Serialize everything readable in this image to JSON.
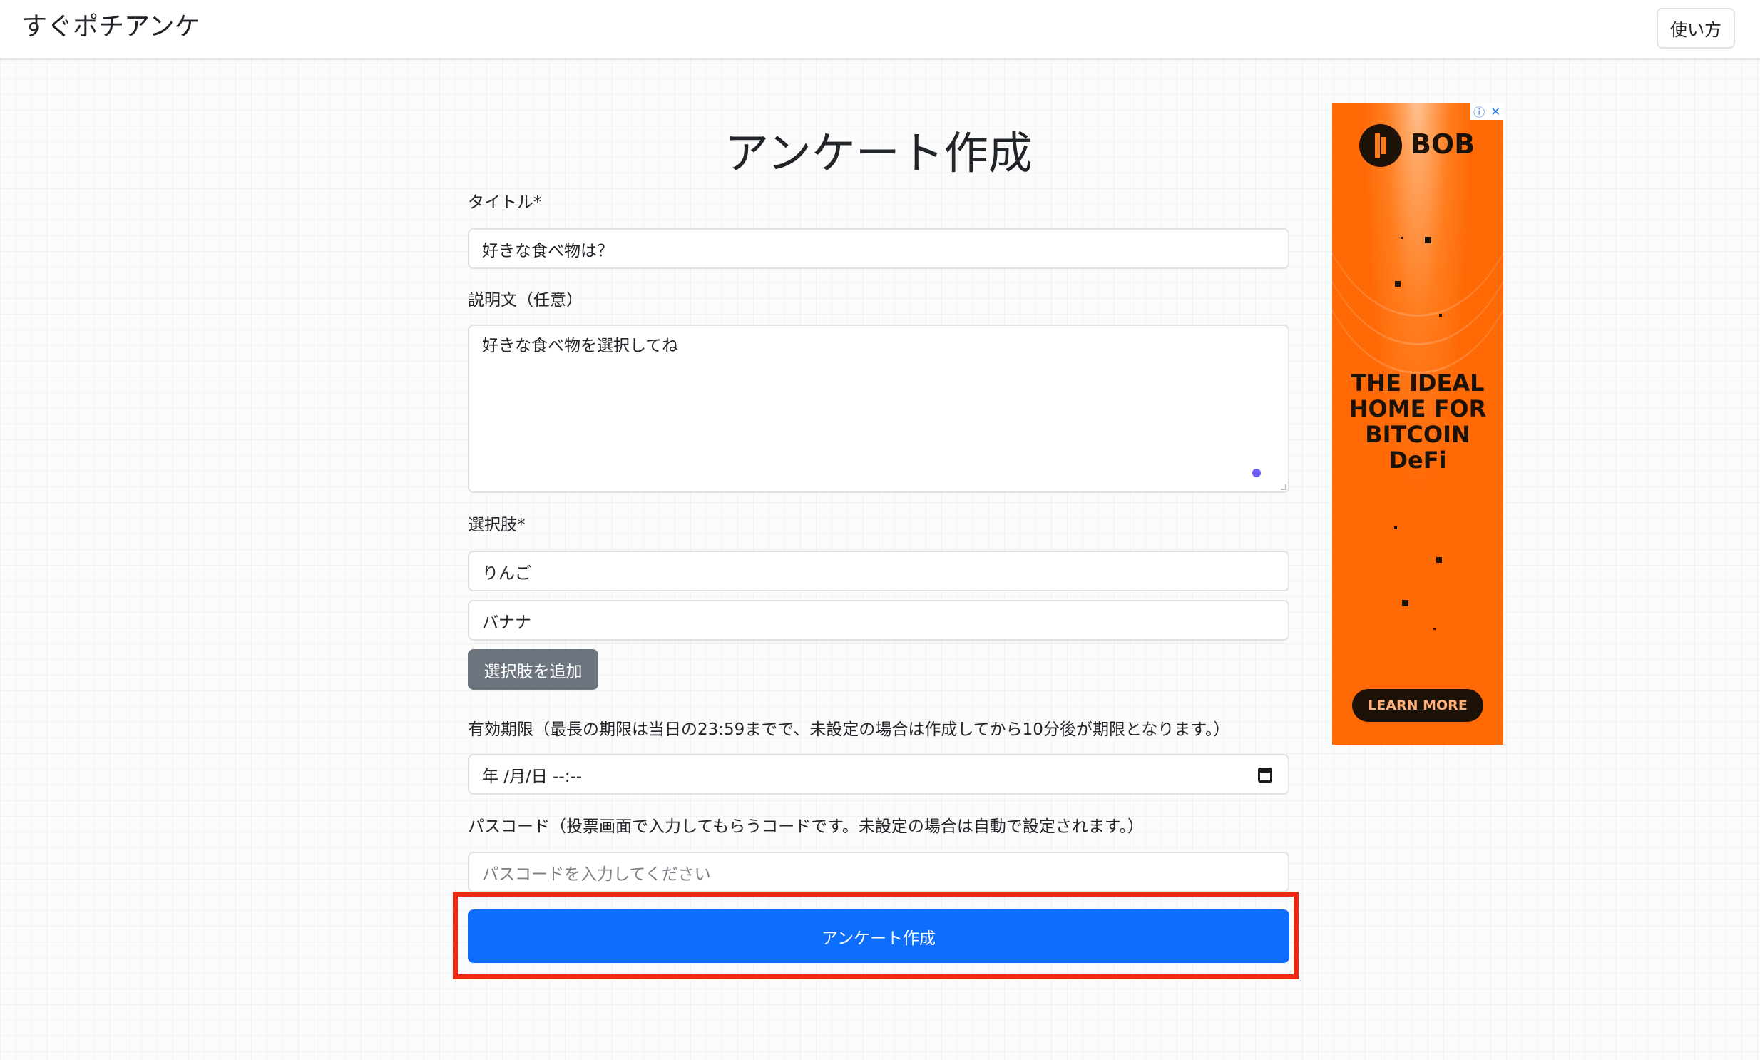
{
  "navbar": {
    "brand": "すぐポチアンケ",
    "howto_label": "使い方"
  },
  "page_title": "アンケート作成",
  "form": {
    "title_label": "タイトル*",
    "title_value": "好きな食べ物は？",
    "description_label": "説明文（任意）",
    "description_value": "好きな食べ物を選択してね",
    "choices_label": "選択肢*",
    "choices": [
      "りんご",
      "バナナ"
    ],
    "add_choice_label": "選択肢を追加",
    "expiry_label": "有効期限（最長の期限は当日の23:59までで、未設定の場合は作成してから10分後が期限となります。）",
    "expiry_value": "年 /月/日 --:--",
    "passcode_label": "パスコード（投票画面で入力してもらうコードです。未設定の場合は自動で設定されます。）",
    "passcode_placeholder": "パスコードを入力してください",
    "submit_label": "アンケート作成"
  },
  "ad": {
    "brand": "BOB",
    "headline": "THE IDEAL\nHOME FOR\nBITCOIN\nDeFi",
    "cta": "LEARN MORE",
    "info_icon": "ⓘ",
    "close_icon": "✕"
  },
  "colors": {
    "primary": "#0d6efd",
    "secondary": "#6c757d",
    "highlight": "#ea2a13",
    "ad_orange": "#ff6a05"
  }
}
